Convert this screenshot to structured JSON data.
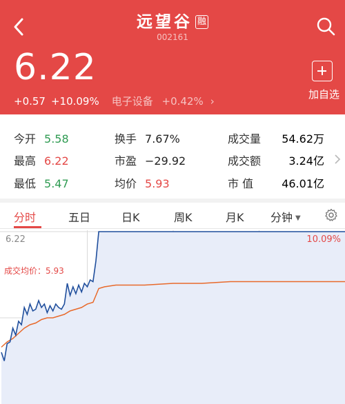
{
  "header": {
    "title": "远望谷",
    "badge": "融",
    "code": "002161",
    "price": "6.22",
    "change": "+0.57",
    "change_pct": "+10.09%",
    "sector": "电子设备",
    "sector_change": "+0.42%",
    "add_label": "加自选",
    "bg_color": "#e44846"
  },
  "stats": {
    "open": {
      "label": "今开",
      "value": "5.58"
    },
    "high": {
      "label": "最高",
      "value": "6.22"
    },
    "low": {
      "label": "最低",
      "value": "5.47"
    },
    "turnover": {
      "label": "换手",
      "value": "7.67%"
    },
    "pe": {
      "label": "市盈",
      "value": "−29.92"
    },
    "avg": {
      "label": "均价",
      "value": "5.93"
    },
    "volume": {
      "label": "成交量",
      "value": "54.62万"
    },
    "amount": {
      "label": "成交额",
      "value": "3.24亿"
    },
    "mktcap": {
      "label": "市 值",
      "value": "46.01亿"
    }
  },
  "tabs": [
    {
      "label": "分时",
      "active": true
    },
    {
      "label": "五日",
      "active": false
    },
    {
      "label": "日K",
      "active": false
    },
    {
      "label": "周K",
      "active": false
    },
    {
      "label": "月K",
      "active": false
    },
    {
      "label": "分钟",
      "active": false
    }
  ],
  "chart": {
    "top_price": "6.22",
    "top_pct": "10.09%",
    "avg_label": "成交均价：5.93"
  },
  "chart_data": {
    "type": "line",
    "ylim": [
      5.22,
      6.22
    ],
    "x_range": [
      0,
      240
    ],
    "series": [
      {
        "x": [
          0,
          2,
          4,
          6,
          8,
          10,
          12,
          14,
          16,
          18,
          20,
          22,
          24,
          26,
          28,
          30,
          32,
          34,
          36,
          38,
          40,
          42,
          44,
          46,
          48,
          50,
          52,
          54,
          56,
          58,
          60,
          62,
          64,
          66,
          68,
          240
        ],
        "values": [
          5.52,
          5.47,
          5.57,
          5.58,
          5.66,
          5.62,
          5.7,
          5.68,
          5.78,
          5.74,
          5.8,
          5.76,
          5.77,
          5.82,
          5.78,
          5.8,
          5.75,
          5.79,
          5.76,
          5.8,
          5.78,
          5.77,
          5.8,
          5.92,
          5.85,
          5.9,
          5.86,
          5.91,
          5.87,
          5.92,
          5.9,
          5.94,
          5.93,
          6.05,
          6.22,
          6.22
        ],
        "color": "#1f4e9c"
      },
      {
        "x": [
          0,
          4,
          8,
          12,
          16,
          20,
          24,
          28,
          32,
          36,
          40,
          44,
          48,
          52,
          56,
          60,
          64,
          66,
          68,
          72,
          80,
          100,
          120,
          140,
          160,
          180,
          200,
          220,
          240
        ],
        "values": [
          5.55,
          5.58,
          5.6,
          5.63,
          5.66,
          5.68,
          5.69,
          5.71,
          5.72,
          5.72,
          5.73,
          5.74,
          5.76,
          5.77,
          5.78,
          5.8,
          5.81,
          5.85,
          5.89,
          5.9,
          5.91,
          5.91,
          5.92,
          5.92,
          5.93,
          5.93,
          5.93,
          5.93,
          5.93
        ],
        "color": "#e8692a"
      }
    ],
    "colors": {
      "price_line": "#1f4e9c",
      "avg_line": "#e8692a",
      "fill": "#e8edf9",
      "grid": "#d9d9d9"
    }
  }
}
